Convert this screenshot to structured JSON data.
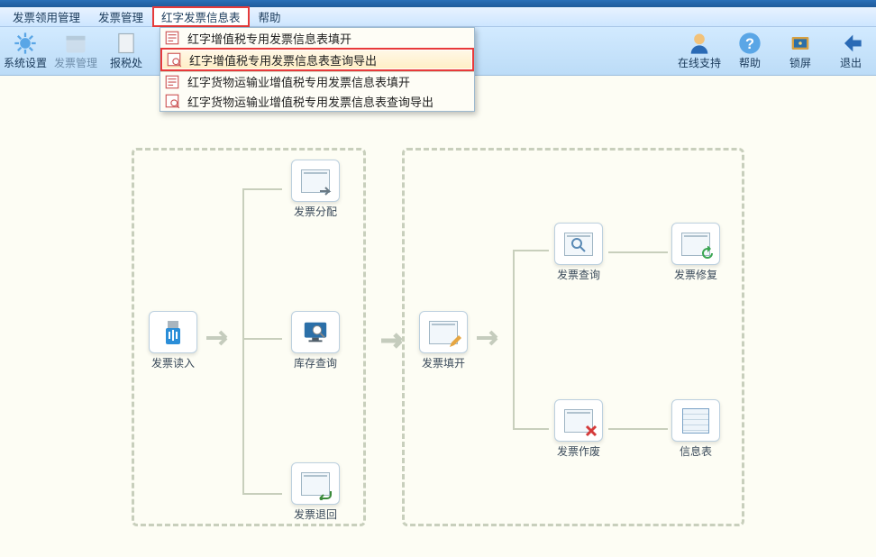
{
  "menubar": {
    "items": [
      "发票领用管理",
      "发票管理",
      "红字发票信息表",
      "帮助"
    ],
    "selected_index": 2
  },
  "toolbar": {
    "left": [
      {
        "label": "系统设置",
        "icon": "gear"
      },
      {
        "label": "发票管理",
        "icon": "calendar",
        "dim": true
      },
      {
        "label": "报税处",
        "icon": "doc",
        "clipped": true
      }
    ],
    "right": [
      {
        "label": "在线支持",
        "icon": "user"
      },
      {
        "label": "帮助",
        "icon": "help"
      },
      {
        "label": "锁屏",
        "icon": "lock"
      },
      {
        "label": "退出",
        "icon": "back"
      }
    ]
  },
  "dropdown": [
    {
      "label": "红字增值税专用发票信息表填开"
    },
    {
      "label": "红字增值税专用发票信息表查询导出",
      "highlight": true
    },
    {
      "label": "红字货物运输业增值税专用发票信息表填开",
      "sep": true
    },
    {
      "label": "红字货物运输业增值税专用发票信息表查询导出"
    }
  ],
  "flow": {
    "left_panel": {
      "entry": {
        "label": "发票读入"
      },
      "branches": [
        {
          "label": "发票分配"
        },
        {
          "label": "库存查询"
        },
        {
          "label": "发票退回"
        }
      ]
    },
    "right_panel": {
      "entry": {
        "label": "发票填开"
      },
      "branches": [
        {
          "label": "发票查询"
        },
        {
          "label": "发票修复"
        },
        {
          "label": "发票作废"
        },
        {
          "label": "信息表"
        }
      ]
    }
  }
}
